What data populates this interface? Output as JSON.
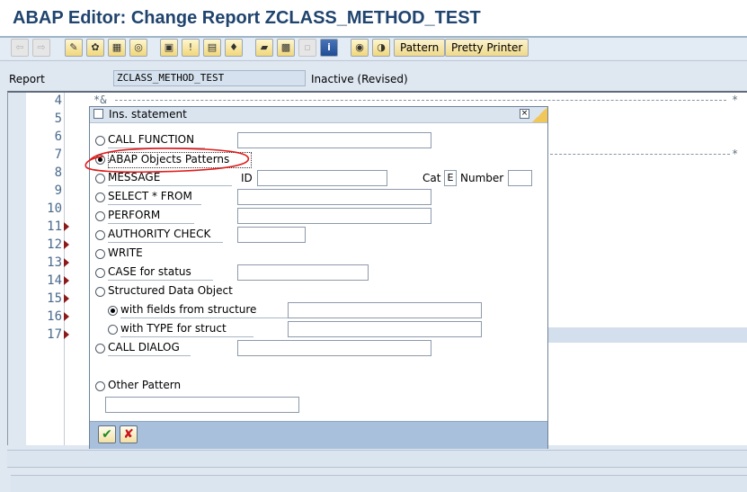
{
  "window": {
    "title": "ABAP Editor: Change Report ZCLASS_METHOD_TEST"
  },
  "toolbar": {
    "pattern_label": "Pattern",
    "pretty_printer_label": "Pretty Printer"
  },
  "report": {
    "label": "Report",
    "value": "ZCLASS_METHOD_TEST",
    "status": "Inactive (Revised)"
  },
  "editor": {
    "line_numbers": [
      "4",
      "5",
      "6",
      "7",
      "8",
      "9",
      "10",
      "11",
      "12",
      "13",
      "14",
      "15",
      "16",
      "17"
    ],
    "comment_line_start": "*&",
    "comment_line_end": "*"
  },
  "dialog": {
    "title": "Ins. statement",
    "options": {
      "call_function": "CALL FUNCTION",
      "abap_objects_patterns": "ABAP Objects Patterns",
      "message": "MESSAGE",
      "select_from": "SELECT * FROM",
      "perform": "PERFORM",
      "authority_check": "AUTHORITY CHECK",
      "write": "WRITE",
      "case_for_status": "CASE for status",
      "structured_data_object": "Structured Data Object",
      "with_fields_from_structure": "with fields from structure",
      "with_type_for_struct": "with TYPE for struct",
      "call_dialog": "CALL DIALOG",
      "other_pattern": "Other Pattern"
    },
    "message_id_label": "ID",
    "message_cat_label": "Cat",
    "message_cat_value": "E",
    "message_number_label": "Number",
    "selected_option": "ABAP Objects Patterns",
    "selected_sub_option": "with fields from structure"
  },
  "annotation": {
    "color": "#e11b1b"
  }
}
